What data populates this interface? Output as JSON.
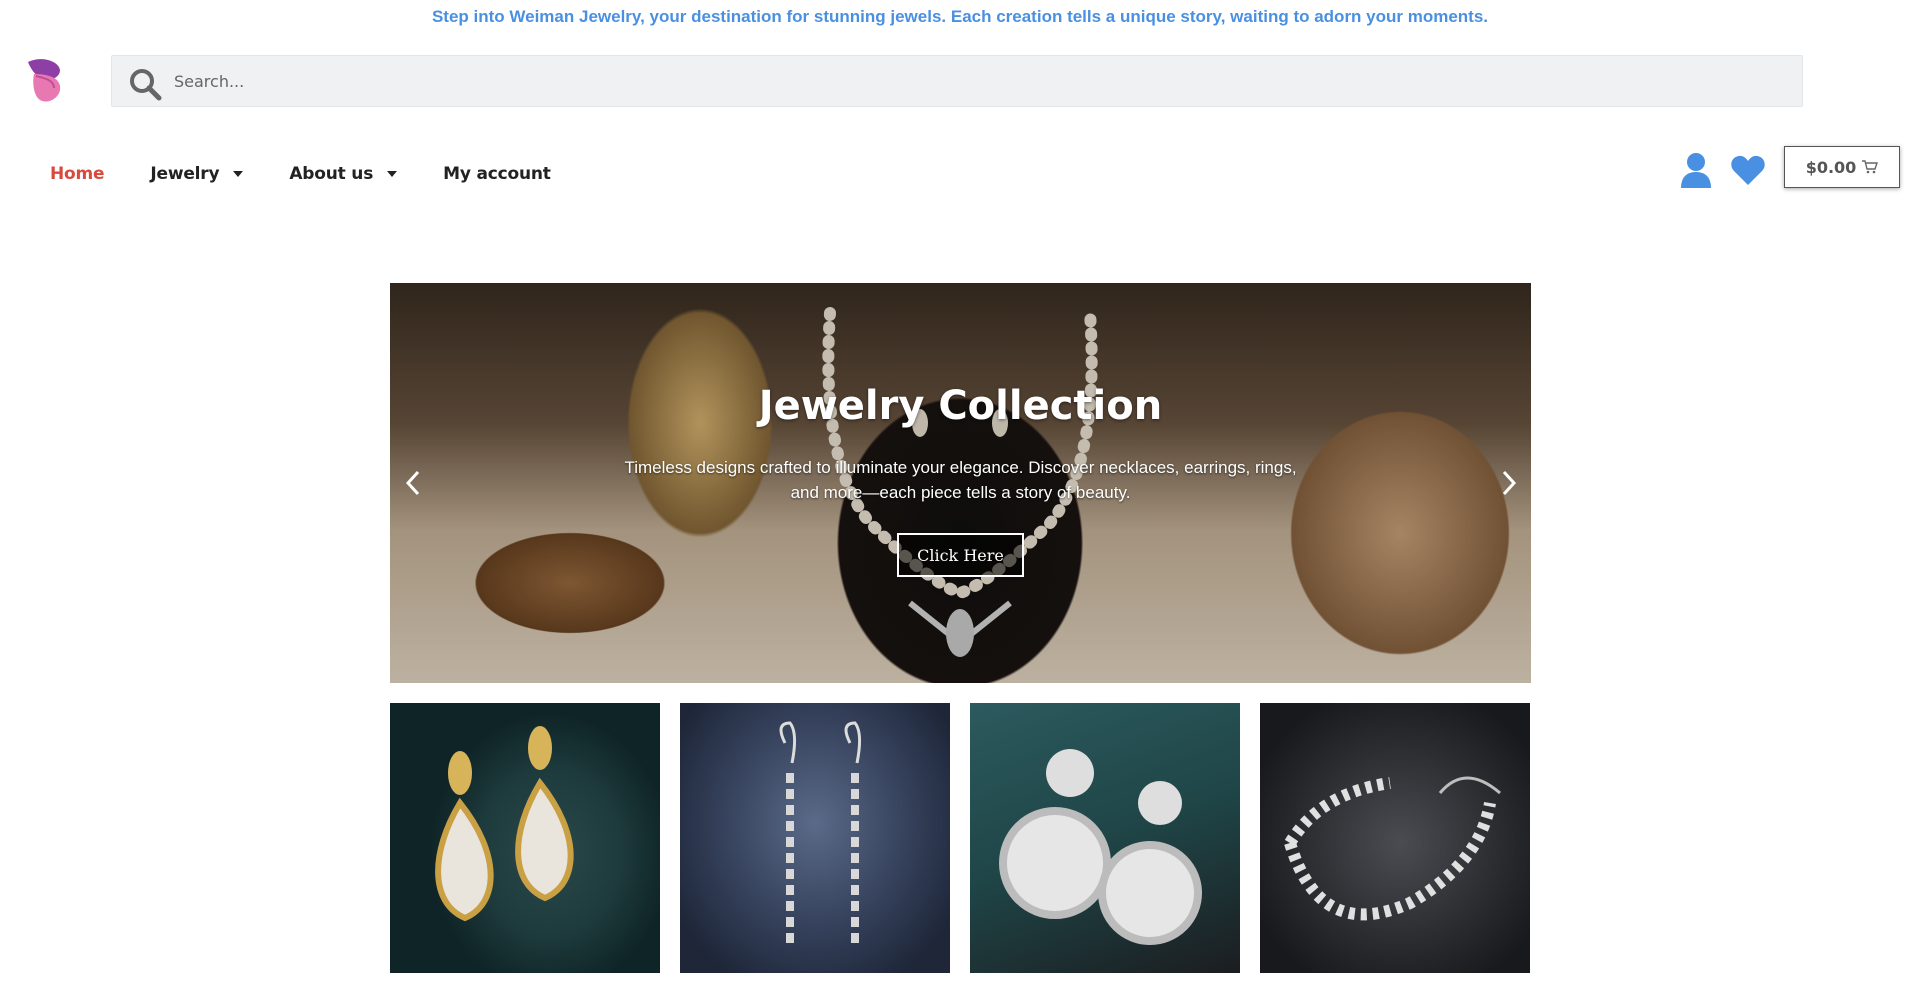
{
  "announcement": "Step into Weiman Jewelry, your destination for stunning jewels. Each creation tells a unique story, waiting to adorn your moments.",
  "search": {
    "placeholder": "Search..."
  },
  "nav": {
    "items": [
      {
        "label": "Home",
        "active": true
      },
      {
        "label": "Jewelry",
        "has_dropdown": true
      },
      {
        "label": "About us",
        "has_dropdown": true
      },
      {
        "label": "My account"
      }
    ]
  },
  "header_icons": {
    "user": "user-icon",
    "wishlist": "heart-icon"
  },
  "cart": {
    "total": "$0.00",
    "icon": "cart-icon"
  },
  "hero": {
    "title": "Jewelry Collection",
    "subtitle": "Timeless designs crafted to illuminate your elegance. Discover necklaces, earrings, rings, and more—each piece tells a story of beauty.",
    "button": "Click Here"
  },
  "products": [
    {
      "name": "gold-teardrop-earrings"
    },
    {
      "name": "silver-leaf-drop-earrings"
    },
    {
      "name": "halo-round-drop-earrings"
    },
    {
      "name": "leaf-tennis-bracelet"
    }
  ],
  "colors": {
    "accent": "#4a90e2",
    "active_nav": "#d94a3d",
    "logo_top": "#8e3fa6",
    "logo_bottom": "#e878b2"
  }
}
